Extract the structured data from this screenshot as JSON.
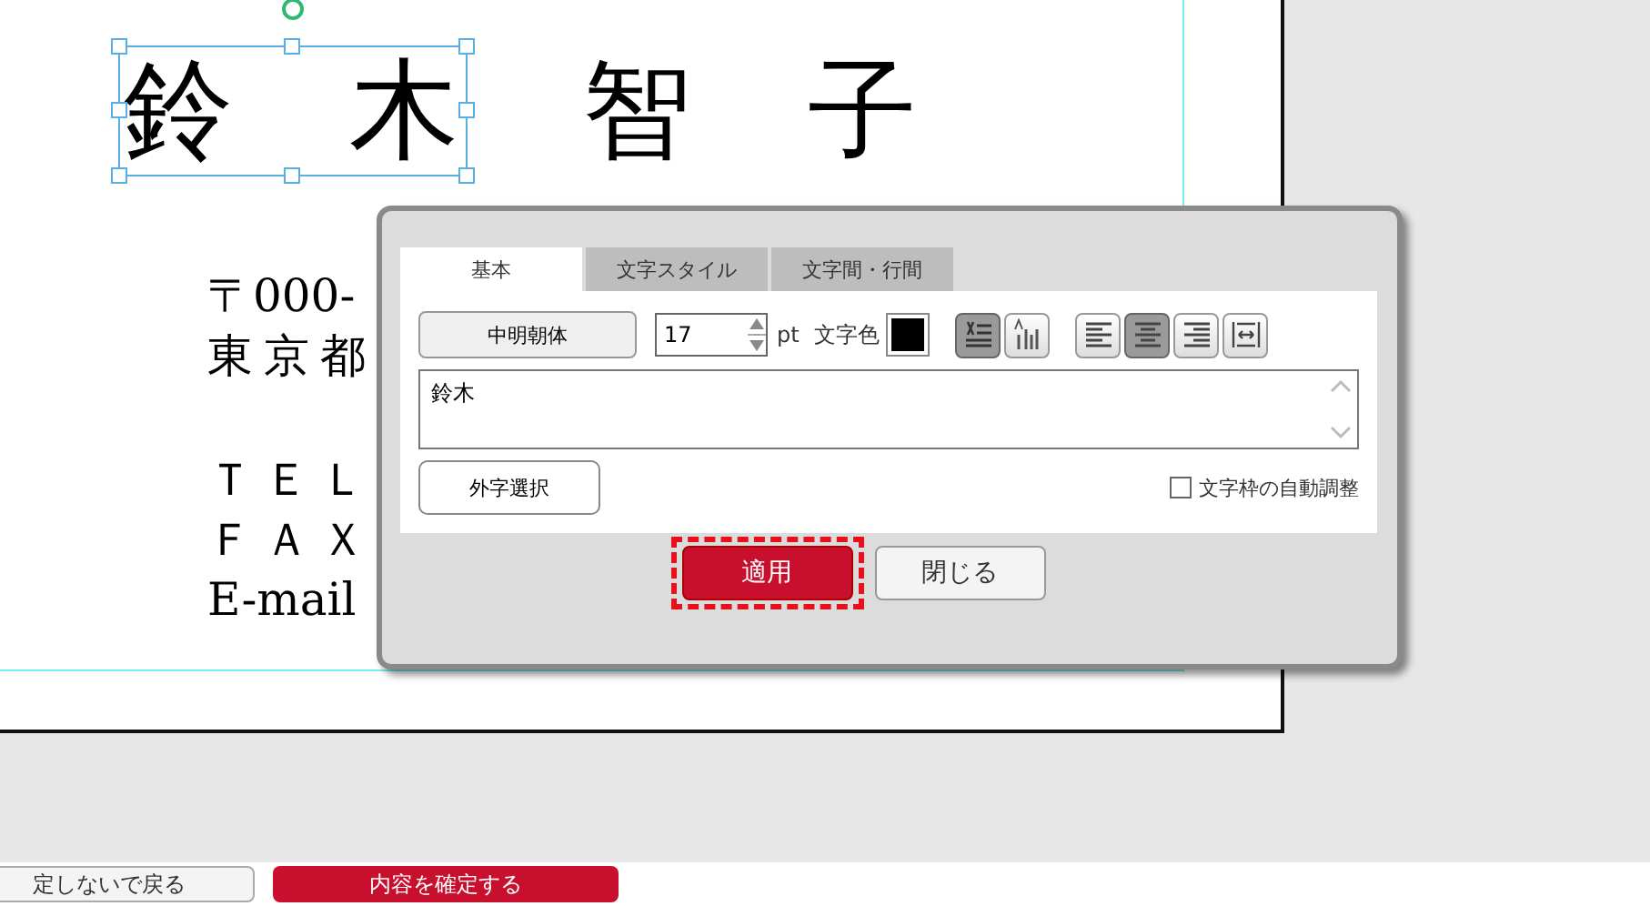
{
  "card": {
    "name_parts": [
      {
        "text": "鈴　木",
        "selected": true
      },
      {
        "text": "智　子",
        "selected": false
      }
    ],
    "address_lines": [
      "〒000-",
      "東京都",
      "ＴＥＬ",
      "ＦＡＸ",
      "E-mail"
    ]
  },
  "dialog": {
    "tabs": [
      {
        "label": "基本",
        "selected": true
      },
      {
        "label": "文字スタイル",
        "selected": false
      },
      {
        "label": "文字間・行間",
        "selected": false
      }
    ],
    "font_button": "中明朝体",
    "size": {
      "value": "17",
      "unit": "pt"
    },
    "color_label": "文字色",
    "direction_buttons": [
      {
        "kind": "horizontal",
        "selected": true
      },
      {
        "kind": "vertical",
        "selected": false
      }
    ],
    "align_buttons": [
      {
        "kind": "left",
        "selected": false
      },
      {
        "kind": "center",
        "selected": true
      },
      {
        "kind": "right",
        "selected": false
      },
      {
        "kind": "justify",
        "selected": false
      }
    ],
    "text_value": "鈴木",
    "gaiji_button": "外字選択",
    "auto_fit": {
      "label": "文字枠の自動調整",
      "checked": false
    },
    "buttons": [
      {
        "label": "適用",
        "kind": "primary",
        "highlighted": true
      },
      {
        "label": "閉じる",
        "kind": "secondary",
        "highlighted": false
      }
    ]
  },
  "footer_buttons": [
    {
      "label": "定しないで戻る",
      "kind": "secondary"
    },
    {
      "label": "内容を確定する",
      "kind": "primary"
    }
  ]
}
